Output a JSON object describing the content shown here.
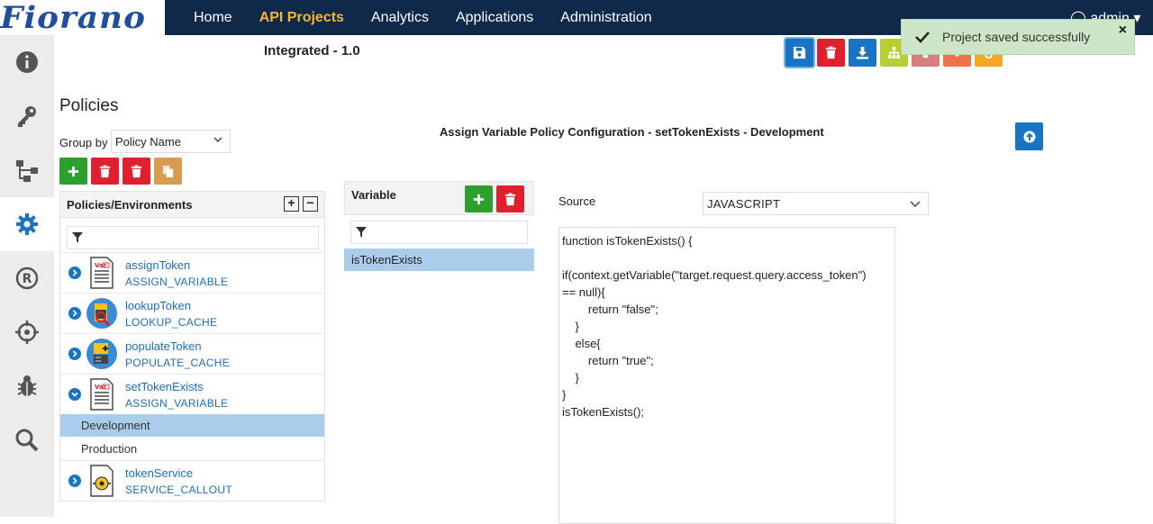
{
  "brand": {
    "logo_text": "Fiorano"
  },
  "nav": {
    "items": [
      "Home",
      "API Projects",
      "Analytics",
      "Applications",
      "Administration"
    ],
    "active": "API Projects"
  },
  "user": {
    "name": "admin"
  },
  "project": {
    "title": "Integrated - 1.0"
  },
  "toast": {
    "message": "Project saved successfully",
    "close": "×"
  },
  "policies": {
    "heading": "Policies",
    "group_by_label": "Group by",
    "group_by_value": "Policy Name",
    "tree_header": "Policies/Environments",
    "nodes": [
      {
        "name": "assignToken",
        "type": "ASSIGN_VARIABLE",
        "icon": "variable-doc-icon"
      },
      {
        "name": "lookupToken",
        "type": "LOOKUP_CACHE",
        "icon": "lookup-cache-icon"
      },
      {
        "name": "populateToken",
        "type": "POPULATE_CACHE",
        "icon": "populate-cache-icon"
      },
      {
        "name": "setTokenExists",
        "type": "ASSIGN_VARIABLE",
        "icon": "variable-doc-icon",
        "expanded": true,
        "environments": [
          "Development",
          "Production"
        ],
        "selected_env": "Development"
      },
      {
        "name": "tokenService",
        "type": "SERVICE_CALLOUT",
        "icon": "service-callout-icon"
      }
    ]
  },
  "variable_panel": {
    "header": "Variable",
    "items": [
      "isTokenExists"
    ],
    "selected": "isTokenExists"
  },
  "config": {
    "title": "Assign Variable Policy Configuration - setTokenExists - Development",
    "source_label": "Source",
    "source_value": "JAVASCRIPT",
    "code_lines": [
      "function isTokenExists() {",
      "",
      "if(context.getVariable(\"target.request.query.access_token\")",
      "== null){",
      "        return \"false\";",
      "    }",
      "    else{",
      "        return \"true\";",
      "    }",
      "}",
      "isTokenExists();"
    ]
  },
  "colors": {
    "nav_bg": "#10284a",
    "accent": "#f5b82e",
    "blue": "#1a74c4",
    "green": "#2ca02c",
    "red": "#e0202f"
  }
}
